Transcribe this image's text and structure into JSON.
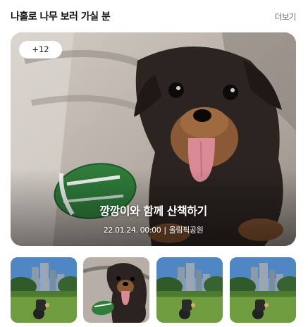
{
  "section": {
    "title": "나홀로 나무 보러 가실 분",
    "more_label": "더보기"
  },
  "hero": {
    "badge": "+12",
    "title": "깡깡이와 함께 산책하기",
    "date": "22.01.24. 00:00",
    "separator": "|",
    "place": "올림픽공원",
    "image": "dachshund-with-football-photo"
  },
  "thumbnails": [
    {
      "image": "park-skyline-stroller-photo"
    },
    {
      "image": "dachshund-closeup-photo"
    },
    {
      "image": "park-skyline-stroller-photo"
    },
    {
      "image": "park-skyline-stroller-photo"
    }
  ]
}
